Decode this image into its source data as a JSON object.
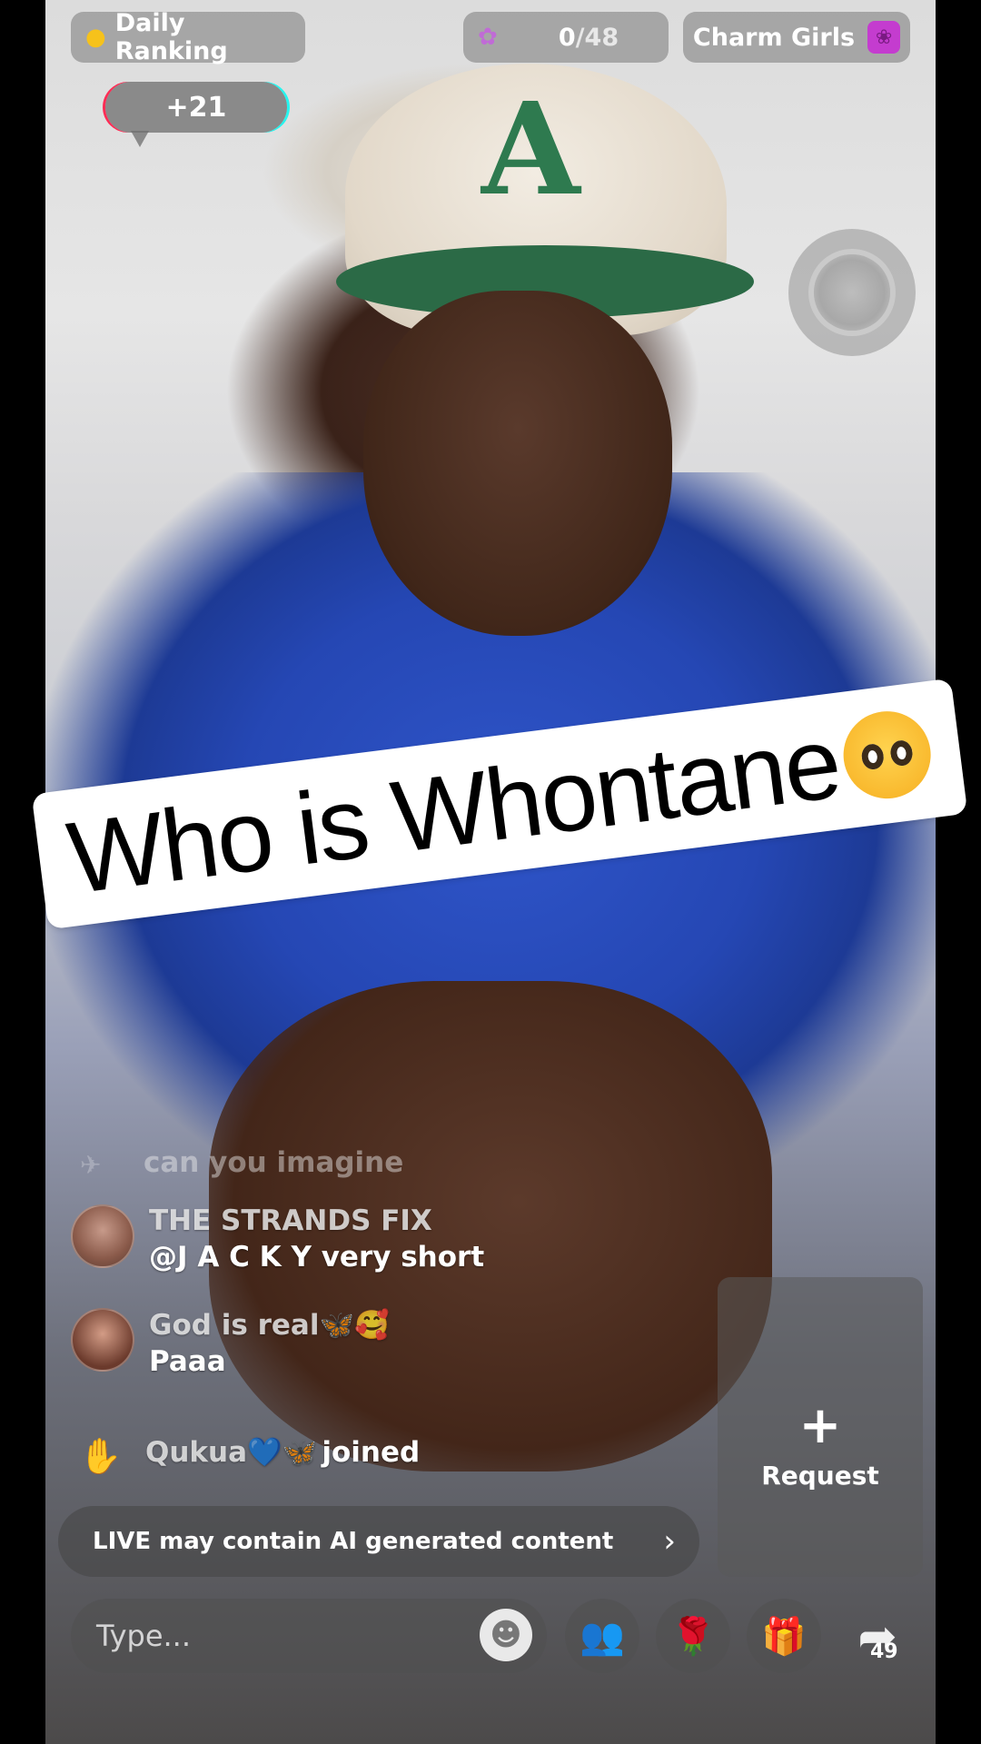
{
  "top_bar": {
    "daily_ranking": "Daily Ranking",
    "counter_current": "0",
    "counter_total": "/48",
    "charm_girls": "Charm Girls"
  },
  "plus_bubble": "+21",
  "caption": "Who is Whontane",
  "comments": {
    "faded": "can you imagine",
    "items": [
      {
        "name": "THE STRANDS FIX",
        "text": "@J A C K Y very short"
      },
      {
        "name": "God is real🦋🥰",
        "text": "Paaa"
      }
    ],
    "join_event": {
      "user": "Qukua💙🦋",
      "action": "joined"
    }
  },
  "request": {
    "label": "Request"
  },
  "ai_notice": "LIVE may contain AI generated content",
  "input": {
    "placeholder": "Type..."
  },
  "share_count": "49"
}
